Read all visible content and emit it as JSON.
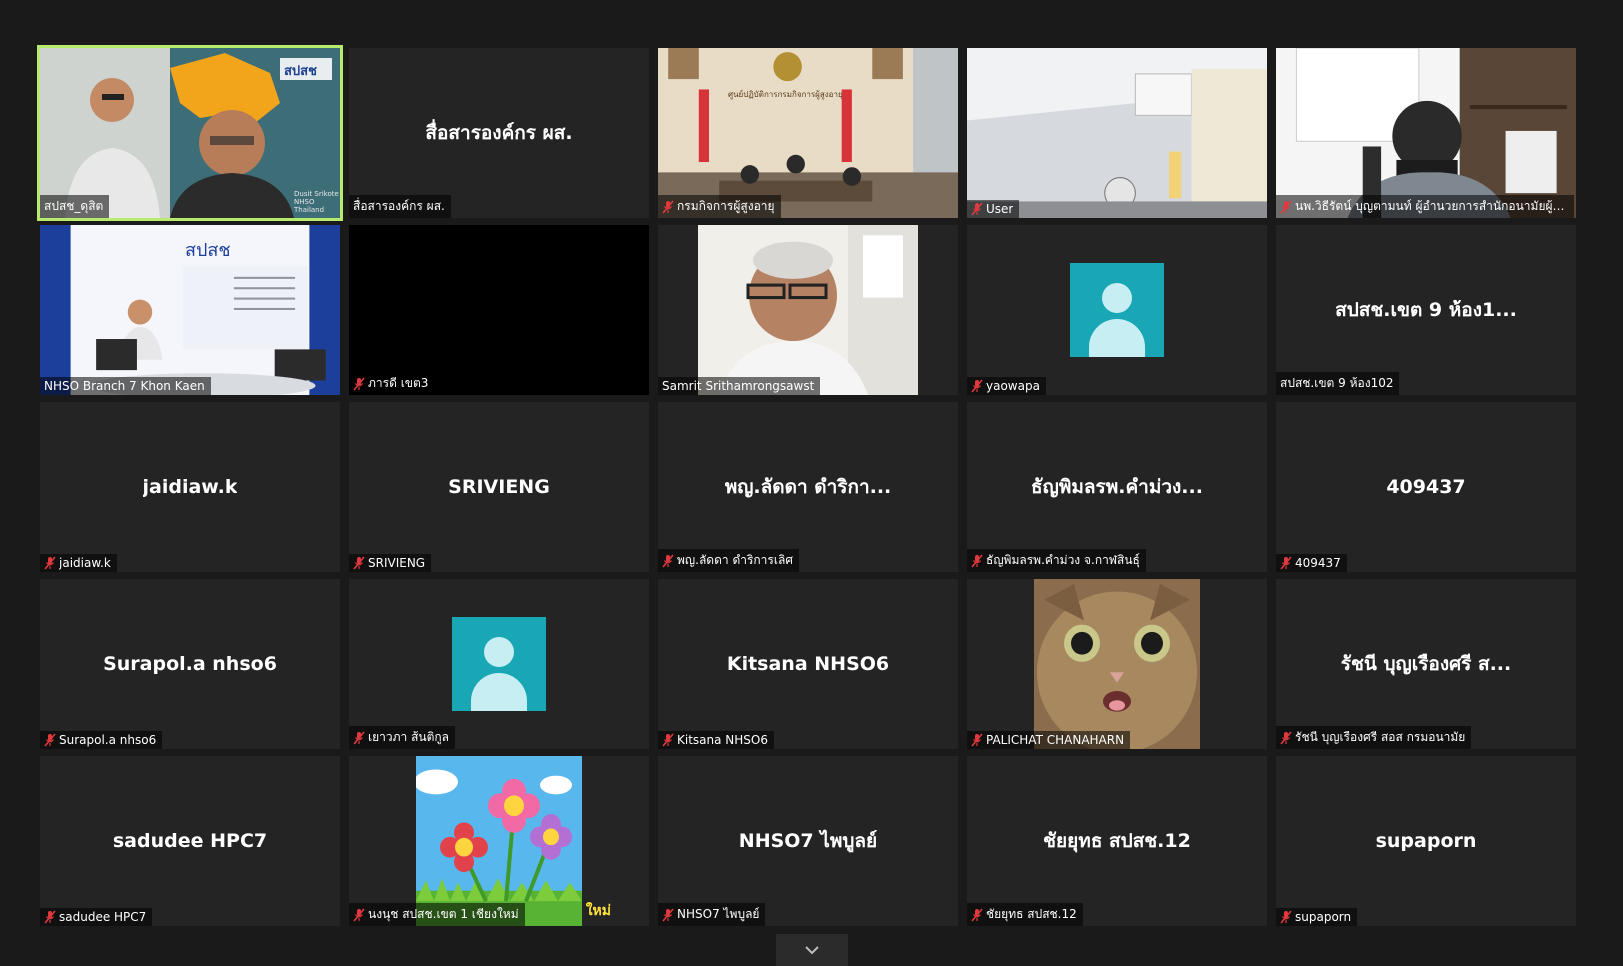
{
  "gallery": {
    "tiles": [
      {
        "type": "video",
        "label": "สปสช_ดุสิต",
        "active": true,
        "muted": false,
        "scene": "two-men"
      },
      {
        "type": "name",
        "name": "สื่อสารองค์กร ผส.",
        "label": "สื่อสารองค์กร ผส.",
        "muted": false
      },
      {
        "type": "video",
        "label": "กรมกิจการผู้สูงอายุ",
        "muted": true,
        "scene": "meeting-room"
      },
      {
        "type": "video",
        "label": "User",
        "muted": true,
        "scene": "office-ceiling"
      },
      {
        "type": "video",
        "label": "นพ.วิธีรัตน์ บุญตามนท์ ผู้อำนวยการสำนักอนามัยผู้สูงอ...",
        "muted": true,
        "scene": "man-mask"
      },
      {
        "type": "video",
        "label": "NHSO Branch 7 Khon Kaen",
        "muted": false,
        "scene": "nhso-branch"
      },
      {
        "type": "black",
        "label": "ภารดี เขต3",
        "muted": true
      },
      {
        "type": "video",
        "label": "Samrit Srithamrongsawst",
        "muted": false,
        "scene": "man-glasses",
        "narrow": true
      },
      {
        "type": "avatar",
        "label": "yaowapa",
        "muted": true
      },
      {
        "type": "name",
        "name": "สปสช.เขต 9 ห้อง1...",
        "label": "สปสช.เขต 9 ห้อง102",
        "muted": false
      },
      {
        "type": "name",
        "name": "jaidiaw.k",
        "label": "jaidiaw.k",
        "muted": true
      },
      {
        "type": "name",
        "name": "SRIVIENG",
        "label": "SRIVIENG",
        "muted": true
      },
      {
        "type": "name",
        "name": "พญ.ลัดดา  ดำริกา...",
        "label": "พญ.ลัดดา  ดำริการเลิศ",
        "muted": true
      },
      {
        "type": "name",
        "name": "ธัญพิมลรพ.คำม่วง...",
        "label": "ธัญพิมลรพ.คำม่วง จ.กาฬสินธุ์",
        "muted": true
      },
      {
        "type": "name",
        "name": "409437",
        "label": "409437",
        "muted": true
      },
      {
        "type": "name",
        "name": "Surapol.a nhso6",
        "label": "Surapol.a nhso6",
        "muted": true
      },
      {
        "type": "avatar",
        "label": "เยาวภา ส้นติกูล",
        "muted": true
      },
      {
        "type": "name",
        "name": "Kitsana NHSO6",
        "label": "Kitsana NHSO6",
        "muted": true
      },
      {
        "type": "video",
        "label": "PALICHAT CHANAHARN",
        "muted": true,
        "scene": "cat",
        "narrow": true
      },
      {
        "type": "name",
        "name": "รัชนี บุญเรืองศรี ส...",
        "label": "รัชนี บุญเรืองศรี สอส กรมอนามัย",
        "muted": true
      },
      {
        "type": "name",
        "name": "sadudee HPC7",
        "label": "sadudee HPC7",
        "muted": true
      },
      {
        "type": "video",
        "label": "นงนุช สปสช.เขต 1 เชียงใหม่",
        "muted": true,
        "scene": "flowers",
        "narrow": true,
        "overlay": "ใหม่"
      },
      {
        "type": "name",
        "name": "NHSO7 ไพบูลย์",
        "label": "NHSO7 ไพบูลย์",
        "muted": true
      },
      {
        "type": "name",
        "name": "ชัยยุทธ  สปสช.12",
        "label": "ชัยยุทธ  สปสช.12",
        "muted": true
      },
      {
        "type": "name",
        "name": "supaporn",
        "label": "supaporn",
        "muted": true
      }
    ]
  },
  "scenes": {
    "two-men": {
      "logo_text": "สปสช",
      "brand_text": "Dusit Srikote",
      "brand_sub": "NHSO Thailand"
    },
    "meeting-room": {
      "sign_text": "ศูนย์ปฏิบัติการกรมกิจการผู้สูงอายุ"
    },
    "nhso-branch": {
      "logo_text": "สปสช"
    }
  },
  "colors": {
    "active_border": "#b9ea70",
    "avatar_bg": "#1aa7b5",
    "muted_icon": "#e0393e"
  }
}
